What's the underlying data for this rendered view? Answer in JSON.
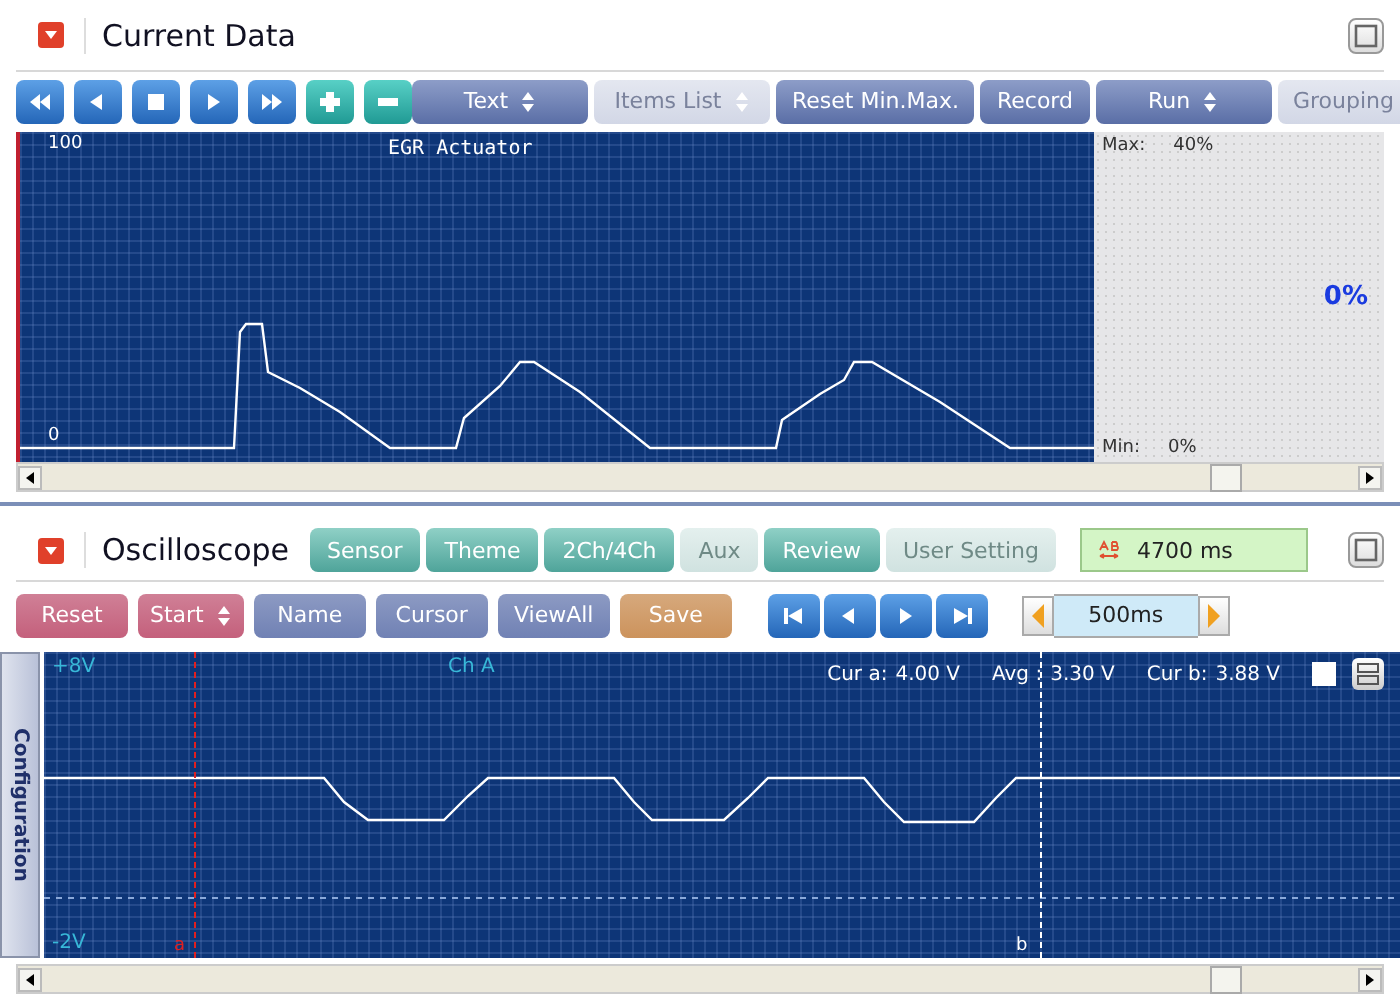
{
  "current_data": {
    "title": "Current Data",
    "transport": [
      {
        "kind": "rewind"
      },
      {
        "kind": "back"
      },
      {
        "kind": "stop"
      },
      {
        "kind": "play"
      },
      {
        "kind": "forward"
      },
      {
        "kind": "plus"
      },
      {
        "kind": "minus"
      }
    ],
    "toolbar": [
      {
        "label": "Text",
        "kind": "dropdown",
        "disabled": false
      },
      {
        "label": "Items List",
        "kind": "dropdown",
        "disabled": true
      },
      {
        "label": "Reset Min.Max.",
        "kind": "button",
        "disabled": false
      },
      {
        "label": "Record",
        "kind": "button",
        "disabled": false
      },
      {
        "label": "Run",
        "kind": "dropdown",
        "disabled": false
      },
      {
        "label": "Grouping",
        "kind": "button",
        "disabled": true
      }
    ],
    "graph": {
      "title": "EGR Actuator",
      "y_max_label": "100",
      "y_min_label": "0"
    },
    "readout": {
      "max_label": "Max:",
      "max_value": "40%",
      "value": "0%",
      "min_label": "Min:",
      "min_value": "0%"
    }
  },
  "oscilloscope": {
    "title": "Oscilloscope",
    "tabs": [
      {
        "label": "Sensor",
        "disabled": false
      },
      {
        "label": "Theme",
        "disabled": false
      },
      {
        "label": "2Ch/4Ch",
        "disabled": false
      },
      {
        "label": "Aux",
        "disabled": true
      },
      {
        "label": "Review",
        "disabled": false
      },
      {
        "label": "User Setting",
        "disabled": true
      }
    ],
    "time_span": "4700 ms",
    "toolbar": [
      {
        "label": "Reset",
        "kind": "button",
        "color": "#c4607c"
      },
      {
        "label": "Start",
        "kind": "dropdown",
        "color": "#c4607c"
      },
      {
        "label": "Name",
        "kind": "button",
        "color": "#7081b4"
      },
      {
        "label": "Cursor",
        "kind": "button",
        "color": "#7081b4"
      },
      {
        "label": "ViewAll",
        "kind": "button",
        "color": "#7081b4"
      },
      {
        "label": "Save",
        "kind": "button",
        "color": "#cc935c"
      }
    ],
    "navigation": [
      {
        "kind": "first"
      },
      {
        "kind": "prev"
      },
      {
        "kind": "next"
      },
      {
        "kind": "last"
      }
    ],
    "timebase": "500ms",
    "scope": {
      "side_tab": "Configuration",
      "top_label": "+8V",
      "bottom_label": "-2V",
      "channel": "Ch A",
      "readouts": [
        {
          "label": "Cur a:",
          "value": "4.00 V"
        },
        {
          "label": "Avg :",
          "value": "3.30 V"
        },
        {
          "label": "Cur b:",
          "value": "3.88 V"
        }
      ],
      "cursors": [
        {
          "label": "a"
        },
        {
          "label": "b"
        }
      ],
      "overlay_checkbox": {
        "checked": false
      }
    }
  }
}
